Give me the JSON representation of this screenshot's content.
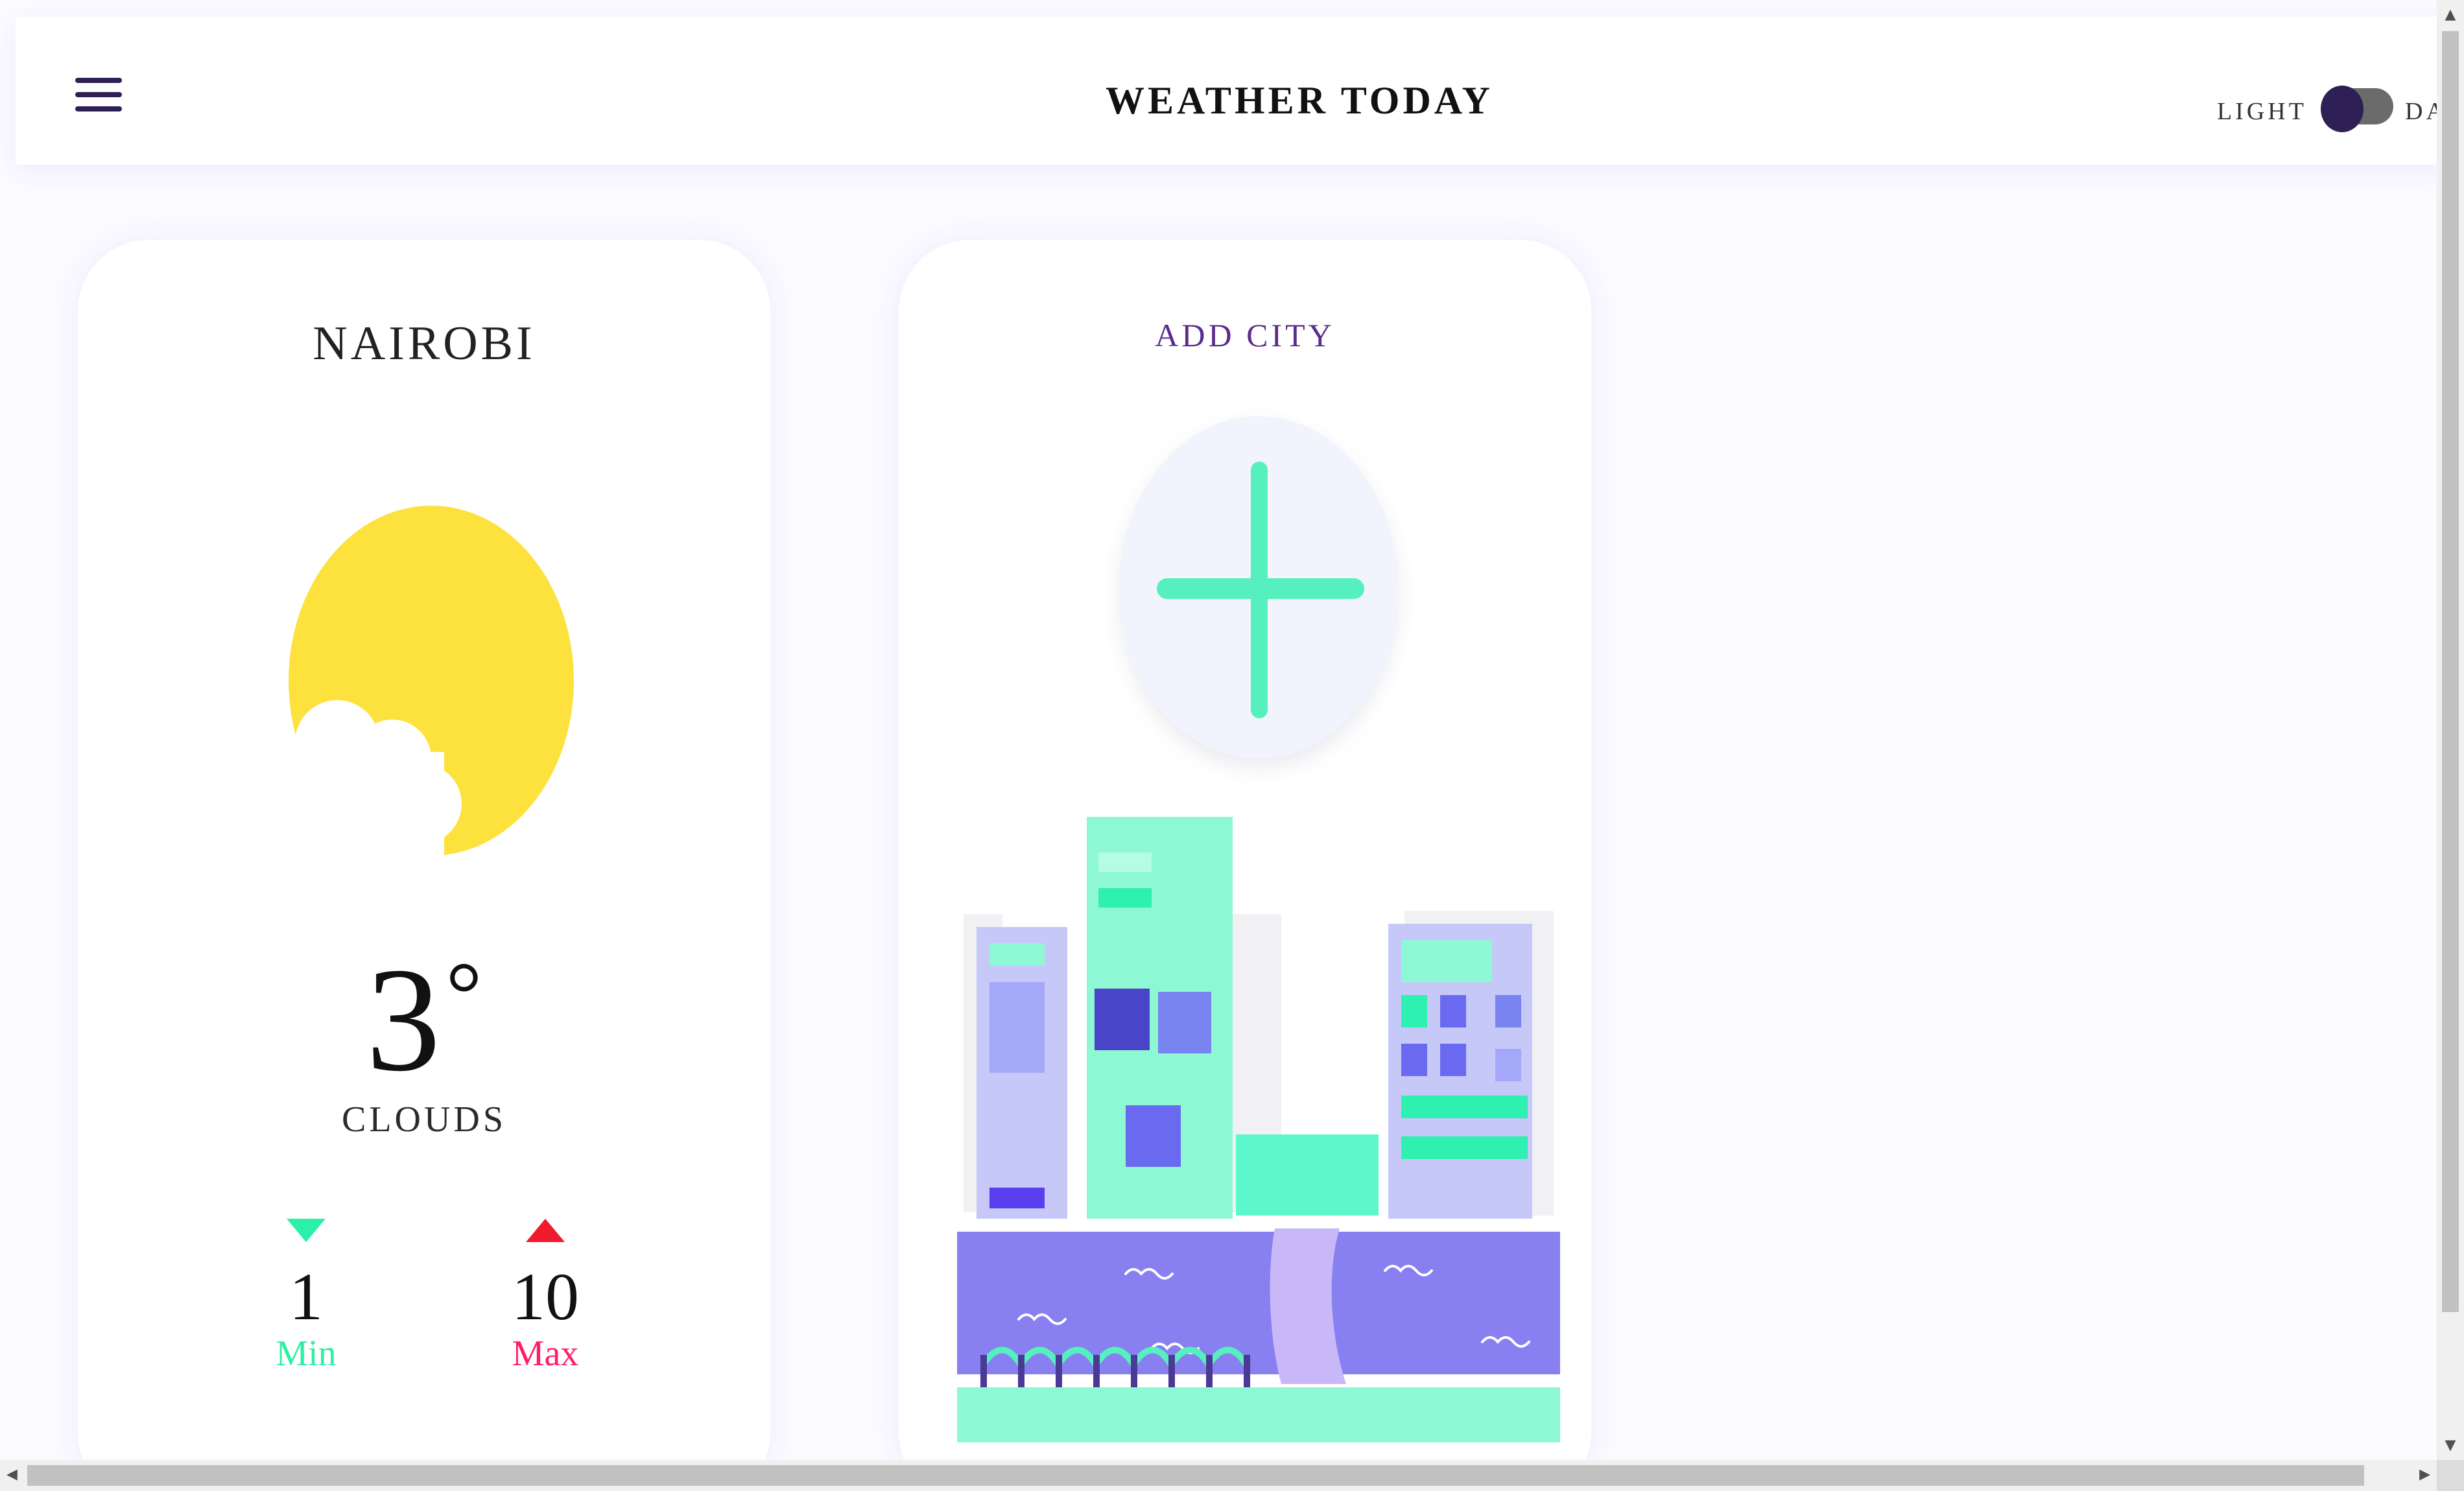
{
  "header": {
    "title": "WEATHER TODAY",
    "menu_icon": "hamburger-menu-icon",
    "theme": {
      "light_label": "LIGHT",
      "dark_label": "DA",
      "mode": "light"
    }
  },
  "weather_card": {
    "city": "NAIROBI",
    "icon": "sun-behind-cloud-icon",
    "temperature": "3",
    "degree_symbol": "°",
    "condition": "CLOUDS",
    "min": {
      "value": "1",
      "label": "Min",
      "icon": "arrow-down-icon"
    },
    "max": {
      "value": "10",
      "label": "Max",
      "icon": "arrow-up-icon"
    }
  },
  "add_card": {
    "label": "ADD CITY",
    "icon": "plus-icon",
    "illustration": "city-skyline-illustration"
  },
  "colors": {
    "accent_green": "#56f0bf",
    "sun_yellow": "#fde23e",
    "min_color": "#2ef0a4",
    "max_color": "#ff1c6c",
    "title_purple": "#5b2c8c",
    "toggle_thumb": "#2e1f54"
  }
}
